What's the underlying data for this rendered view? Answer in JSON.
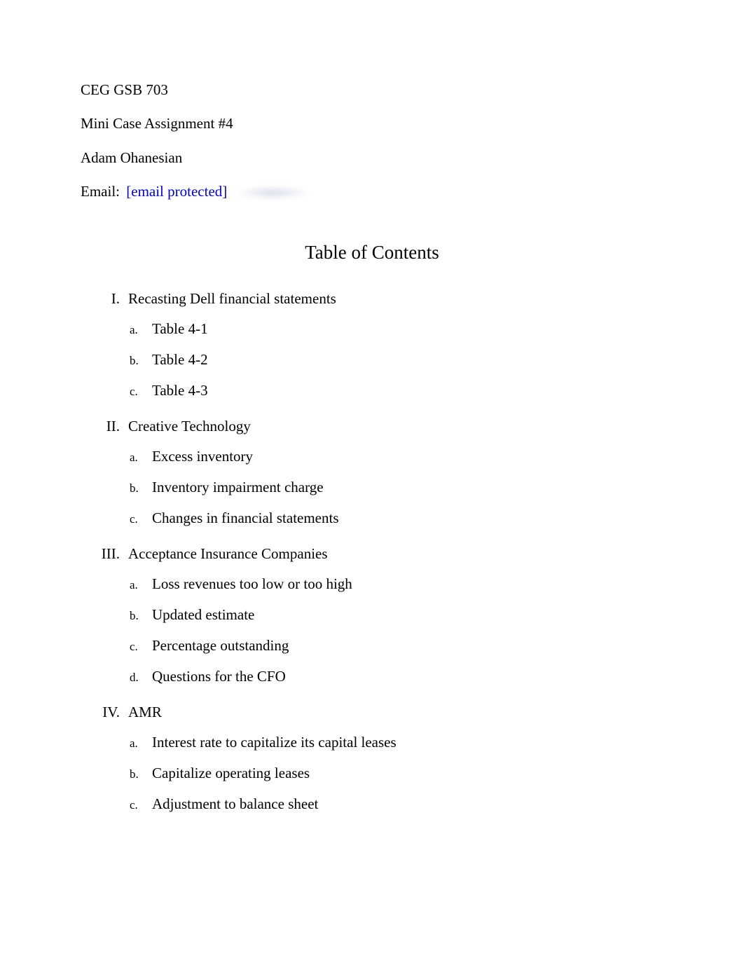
{
  "header": {
    "course": "CEG GSB 703",
    "assignment": "Mini Case Assignment #4",
    "author": "Adam Ohanesian",
    "email_label": "Email:",
    "email_text": "[email protected]"
  },
  "toc_title": "Table of Contents",
  "sections": [
    {
      "roman": "I.",
      "title": "Recasting Dell financial statements",
      "items": [
        {
          "letter": "a.",
          "text": "Table 4-1"
        },
        {
          "letter": "b.",
          "text": "Table 4-2"
        },
        {
          "letter": "c.",
          "text": "Table 4-3"
        }
      ]
    },
    {
      "roman": "II.",
      "title": "Creative Technology",
      "items": [
        {
          "letter": "a.",
          "text": "Excess inventory"
        },
        {
          "letter": "b.",
          "text": "Inventory impairment charge"
        },
        {
          "letter": "c.",
          "text": "Changes in financial statements"
        }
      ]
    },
    {
      "roman": "III.",
      "title": "Acceptance Insurance Companies",
      "items": [
        {
          "letter": "a.",
          "text": "Loss revenues too low or too high"
        },
        {
          "letter": "b.",
          "text": "Updated estimate"
        },
        {
          "letter": "c.",
          "text": "Percentage outstanding"
        },
        {
          "letter": "d.",
          "text": "Questions for the CFO"
        }
      ]
    },
    {
      "roman": "IV.",
      "title": "AMR",
      "items": [
        {
          "letter": "a.",
          "text": "Interest rate to capitalize its capital leases"
        },
        {
          "letter": "b.",
          "text": "Capitalize operating leases"
        },
        {
          "letter": "c.",
          "text": "Adjustment to balance sheet"
        }
      ]
    }
  ]
}
